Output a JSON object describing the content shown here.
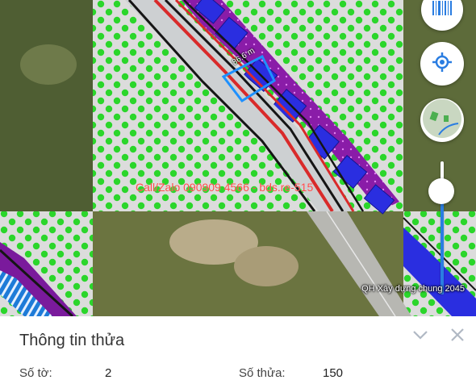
{
  "map": {
    "watermark": "Call/Zalo 090909 4566 - bds.re-515",
    "measurement": "86.6 m",
    "layer_slider_label": "QH Xây dựng chung 2045",
    "layer_opacity_percent": 80,
    "colors": {
      "green_zone_dot": "#2bd62b",
      "residential_zone": "#7a1a9c",
      "lot_blue": "#2a2ee0",
      "road_red": "#d92a2a",
      "measure_line": "#1e90ff"
    }
  },
  "controls": {
    "barcode_icon": "barcode-icon",
    "locate_icon": "locate-icon",
    "layer_icon": "layer-thumbnail-icon"
  },
  "panel": {
    "title": "Thông tin thửa",
    "collapse_icon": "chevron-down-icon",
    "close_icon": "close-icon",
    "so_to_label": "Số tờ:",
    "so_to_value": "2",
    "so_thua_label": "Số thửa:",
    "so_thua_value": "150"
  }
}
